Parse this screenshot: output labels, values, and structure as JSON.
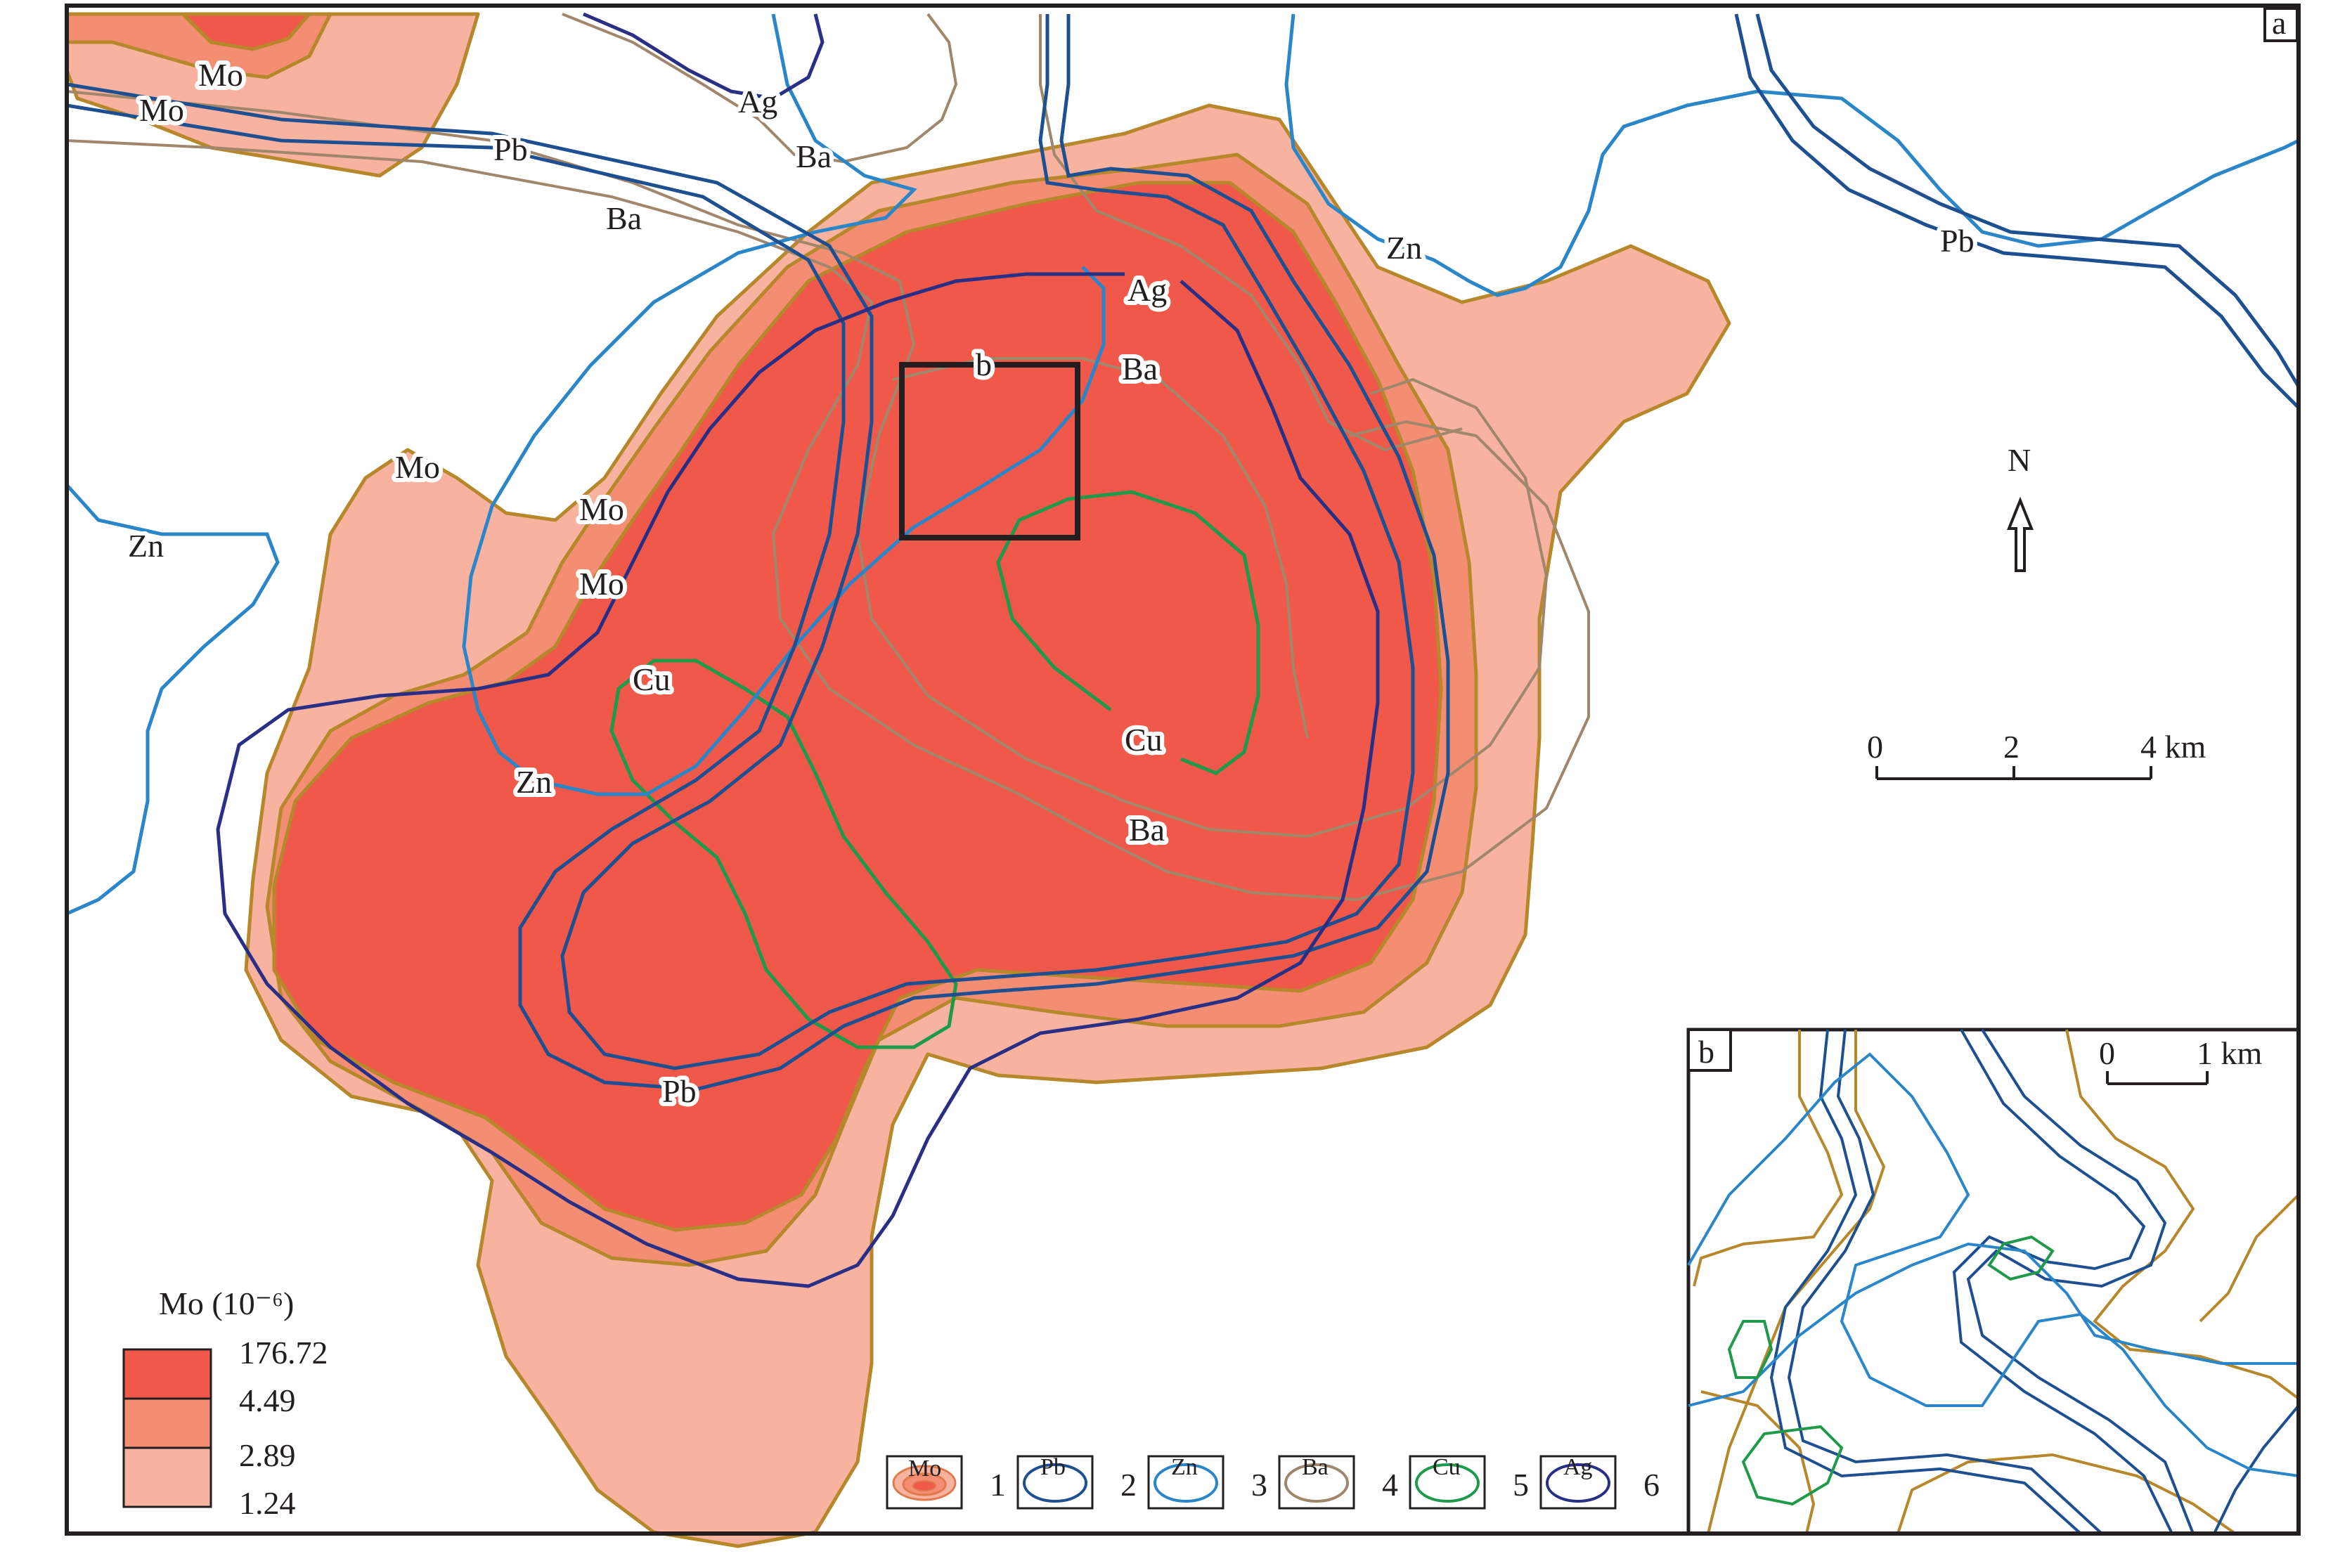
{
  "panel_a_label": "a",
  "panel_b_label": "b",
  "box_label": "b",
  "north_label": "N",
  "scale_main": {
    "ticks": [
      "0",
      "2",
      "4 km"
    ]
  },
  "scale_inset": {
    "ticks": [
      "0",
      "1 km"
    ]
  },
  "contour_labels": {
    "mo_top1": "Mo",
    "mo_top2": "Mo",
    "mo_west": "Mo",
    "mo_mid1": "Mo",
    "mo_mid2": "Mo",
    "pb_top": "Pb",
    "pb_right": "Pb",
    "pb_bottom": "Pb",
    "ag_top": "Ag",
    "ag_center": "Ag",
    "ba_top1": "Ba",
    "ba_top2": "Ba",
    "ba_center": "Ba",
    "ba_lower": "Ba",
    "zn_top": "Zn",
    "zn_left": "Zn",
    "zn_lower": "Zn",
    "cu_upper": "Cu",
    "cu_lower": "Cu"
  },
  "legend": {
    "title": "Mo (10⁻⁶)",
    "values": [
      "176.72",
      "4.49",
      "2.89",
      "1.24"
    ],
    "colors": [
      "#f0584a",
      "#f48e73",
      "#f7b3a0"
    ],
    "items": [
      {
        "symbol_text": "Mo",
        "number": "1",
        "color": "#e07a4e"
      },
      {
        "symbol_text": "Pb",
        "number": "2",
        "color": "#1d4f91"
      },
      {
        "symbol_text": "Zn",
        "number": "3",
        "color": "#2a86c8"
      },
      {
        "symbol_text": "Ba",
        "number": "4",
        "color": "#a0876b"
      },
      {
        "symbol_text": "Cu",
        "number": "5",
        "color": "#1f9a4a"
      },
      {
        "symbol_text": "Ag",
        "number": "6",
        "color": "#2a2f86"
      }
    ]
  },
  "colors": {
    "mo_outline": "#b7872b",
    "mo_high": "#f0584a",
    "mo_mid": "#f48e73",
    "mo_low": "#f7b3a0",
    "pb": "#1d4f91",
    "zn": "#2a86c8",
    "ba": "#a0876b",
    "cu": "#1f9a4a",
    "ag": "#2a2f86",
    "frame": "#231f20"
  }
}
